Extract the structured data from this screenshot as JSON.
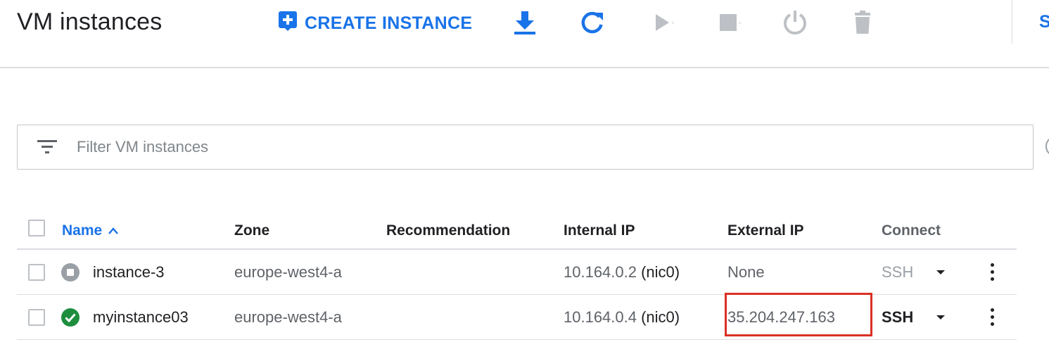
{
  "header": {
    "title": "VM instances",
    "create_label": "CREATE INSTANCE",
    "toolbar_icons": [
      "download-icon",
      "refresh-icon",
      "start-icon",
      "stop-icon",
      "power-icon",
      "delete-icon"
    ],
    "cut_text": "S"
  },
  "filter": {
    "placeholder": "Filter VM instances",
    "value": ""
  },
  "table": {
    "columns": {
      "name": "Name",
      "zone": "Zone",
      "recommendation": "Recommendation",
      "internal_ip": "Internal IP",
      "external_ip": "External IP",
      "connect": "Connect"
    },
    "sort": {
      "column": "Name",
      "direction": "ascending"
    },
    "rows": [
      {
        "status": "stopped",
        "name": "instance-3",
        "zone": "europe-west4-a",
        "recommendation": "",
        "internal_ip": "10.164.0.2",
        "nic": "(nic0)",
        "external_ip": "None",
        "connect": "SSH",
        "connect_enabled": false
      },
      {
        "status": "running",
        "name": "myinstance03",
        "zone": "europe-west4-a",
        "recommendation": "",
        "internal_ip": "10.164.0.4",
        "nic": "(nic0)",
        "external_ip": "35.204.247.163",
        "connect": "SSH",
        "connect_enabled": true
      }
    ]
  },
  "colors": {
    "accent": "#1a73e8",
    "running": "#1e8e3e",
    "stopped": "#9aa0a6",
    "highlight": "#d93025",
    "disabled_icon": "#bdc1c6"
  }
}
